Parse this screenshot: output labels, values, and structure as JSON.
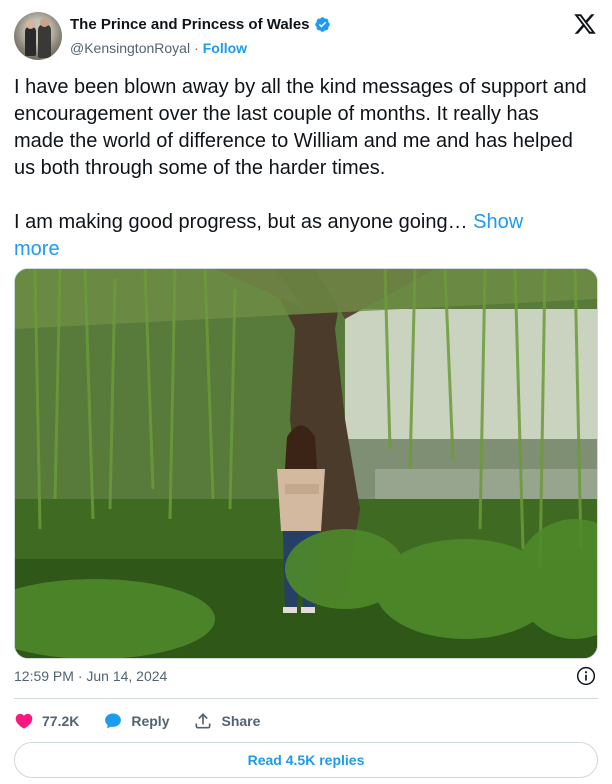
{
  "author": {
    "display_name": "The Prince and Princess of Wales",
    "handle": "@KensingtonRoyal",
    "separator": "·",
    "follow_label": "Follow",
    "verified": true
  },
  "brand_icon": "x-logo-icon",
  "tweet": {
    "text": "I have been blown away by all the kind messages of support and encouragement over the last couple of months. It really has made the world of difference to William and me and has helped us both through some of the harder times.\n\nI am making good progress, but as anyone going… ",
    "show_more_label": "Show\nmore"
  },
  "meta": {
    "timestamp": "12:59 PM · Jun 14, 2024",
    "info_icon": "info-icon"
  },
  "actions": {
    "like": {
      "icon": "heart-icon",
      "count": "77.2K"
    },
    "reply": {
      "icon": "reply-bubble-icon",
      "label": "Reply"
    },
    "share": {
      "icon": "share-icon",
      "label": "Share"
    }
  },
  "read_replies_label": "Read 4.5K replies",
  "colors": {
    "accent": "#1d9bf0",
    "like": "#f91880",
    "text": "#0f1419",
    "muted": "#536471",
    "border": "#cfd9de"
  }
}
